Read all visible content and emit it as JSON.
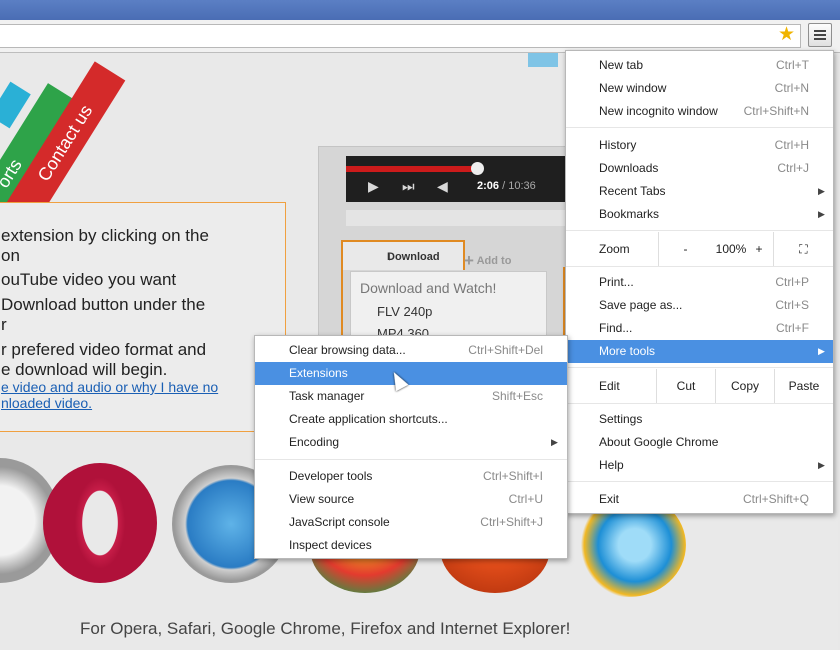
{
  "page": {
    "ribbons": [
      "Contact us",
      "orts"
    ],
    "instructions": [
      "extension by clicking on the",
      "on",
      "ouTube video you want",
      "Download button under the",
      "r",
      "r prefered video format and",
      "e download will begin."
    ],
    "help_link_lines": [
      "e video and audio or why I have no",
      "nloaded video."
    ],
    "player": {
      "time_current": "2:06",
      "time_total": "/ 10:36"
    },
    "download_tab": "Download",
    "add_to": "Add to",
    "download_list": {
      "header": "Download and Watch!",
      "items": [
        "FLV 240p",
        "MP4 360"
      ]
    },
    "caption": "For Opera, Safari, Google Chrome, Firefox and Internet Explorer!"
  },
  "chrome_menu": {
    "items1": [
      {
        "label": "New tab",
        "shortcut": "Ctrl+T"
      },
      {
        "label": "New window",
        "shortcut": "Ctrl+N"
      },
      {
        "label": "New incognito window",
        "shortcut": "Ctrl+Shift+N"
      }
    ],
    "items2": [
      {
        "label": "History",
        "shortcut": "Ctrl+H"
      },
      {
        "label": "Downloads",
        "shortcut": "Ctrl+J"
      },
      {
        "label": "Recent Tabs",
        "shortcut": ""
      },
      {
        "label": "Bookmarks",
        "shortcut": ""
      }
    ],
    "zoom": {
      "label": "Zoom",
      "minus": "-",
      "value": "100%",
      "plus": "+"
    },
    "items3": [
      {
        "label": "Print...",
        "shortcut": "Ctrl+P"
      },
      {
        "label": "Save page as...",
        "shortcut": "Ctrl+S"
      },
      {
        "label": "Find...",
        "shortcut": "Ctrl+F"
      },
      {
        "label": "More tools",
        "shortcut": ""
      }
    ],
    "edit": {
      "label": "Edit",
      "cut": "Cut",
      "copy": "Copy",
      "paste": "Paste"
    },
    "items4": [
      {
        "label": "Settings",
        "shortcut": ""
      },
      {
        "label": "About Google Chrome",
        "shortcut": ""
      },
      {
        "label": "Help",
        "shortcut": ""
      }
    ],
    "exit": {
      "label": "Exit",
      "shortcut": "Ctrl+Shift+Q"
    }
  },
  "more_tools_menu": {
    "group1": [
      {
        "label": "Clear browsing data...",
        "shortcut": "Ctrl+Shift+Del"
      },
      {
        "label": "Extensions",
        "shortcut": ""
      },
      {
        "label": "Task manager",
        "shortcut": "Shift+Esc"
      },
      {
        "label": "Create application shortcuts...",
        "shortcut": ""
      },
      {
        "label": "Encoding",
        "shortcut": ""
      }
    ],
    "group2": [
      {
        "label": "Developer tools",
        "shortcut": "Ctrl+Shift+I"
      },
      {
        "label": "View source",
        "shortcut": "Ctrl+U"
      },
      {
        "label": "JavaScript console",
        "shortcut": "Ctrl+Shift+J"
      },
      {
        "label": "Inspect devices",
        "shortcut": ""
      }
    ]
  }
}
